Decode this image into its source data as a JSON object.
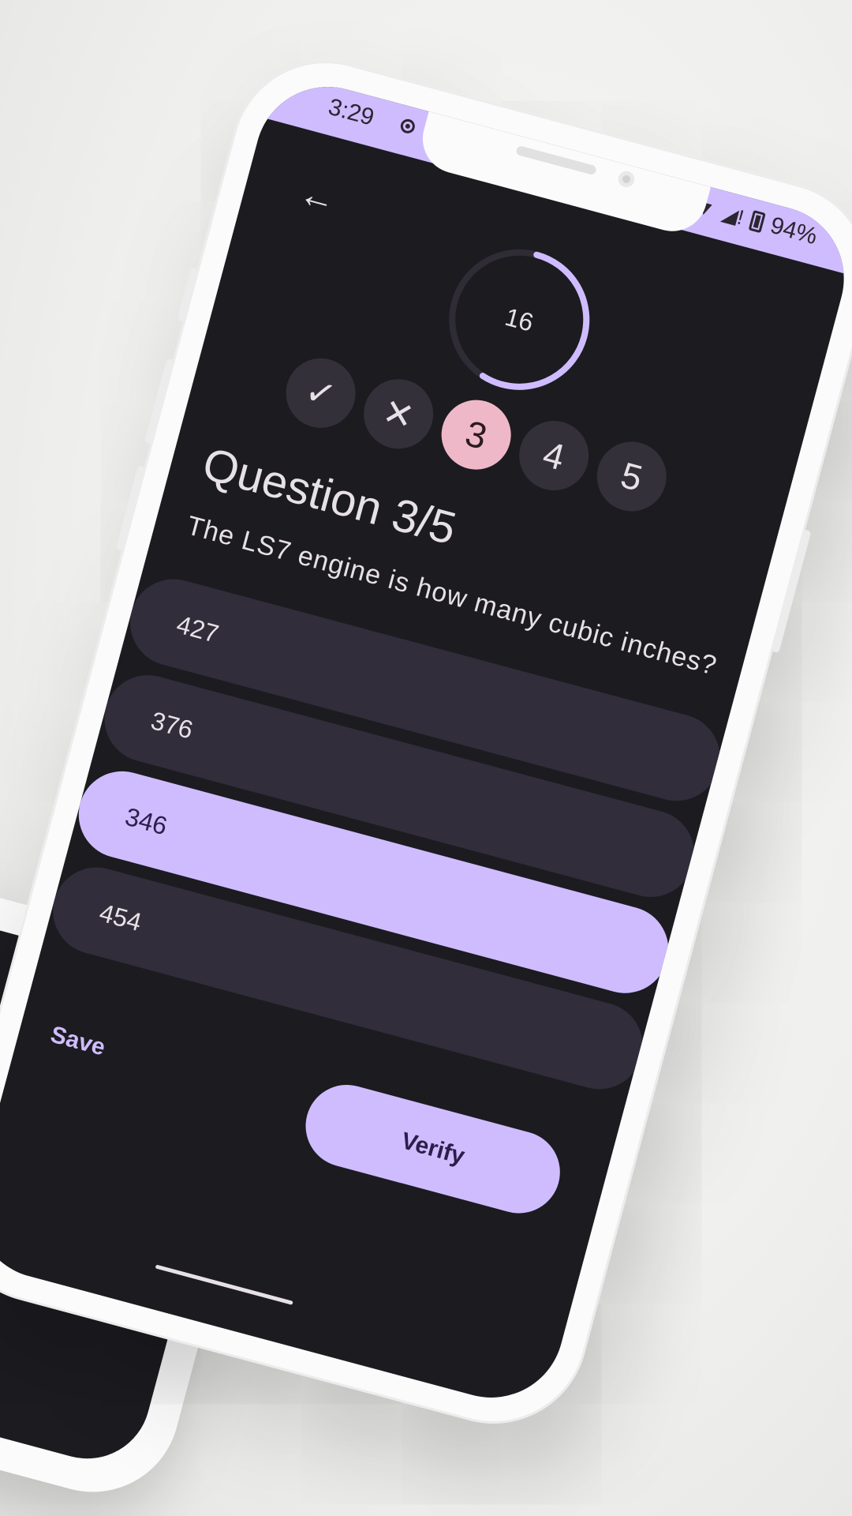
{
  "status_bar": {
    "time": "3:29",
    "battery": "94%",
    "icons": [
      "record-icon",
      "wifi-icon",
      "signal-icon",
      "battery-charging-icon"
    ]
  },
  "nav": {
    "back_icon": "arrow-left-icon"
  },
  "timer": {
    "seconds_left": "16",
    "progress_fraction": 0.55
  },
  "steps": [
    {
      "label": "✓",
      "state": "correct",
      "icon": "check-icon"
    },
    {
      "label": "✕",
      "state": "wrong",
      "icon": "close-icon"
    },
    {
      "label": "3",
      "state": "current"
    },
    {
      "label": "4",
      "state": "pending"
    },
    {
      "label": "5",
      "state": "pending"
    }
  ],
  "question": {
    "title": "Question 3/5",
    "text": "The LS7 engine is how many cubic inches?"
  },
  "options": [
    {
      "label": "427",
      "selected": false
    },
    {
      "label": "376",
      "selected": false
    },
    {
      "label": "346",
      "selected": true
    },
    {
      "label": "454",
      "selected": false
    }
  ],
  "actions": {
    "save_label": "Save",
    "verify_label": "Verify"
  },
  "colors": {
    "accent": "#cfbcff",
    "current_step": "#efb8c8",
    "background": "#1c1b20",
    "surface": "#312d3a"
  }
}
